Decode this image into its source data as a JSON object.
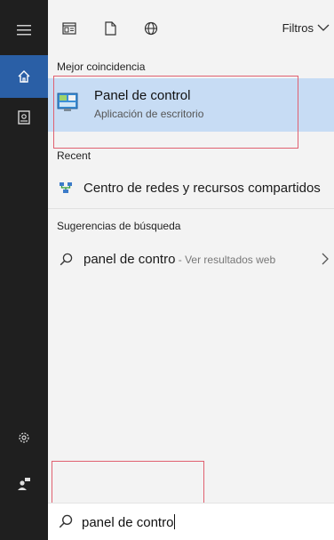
{
  "toolbar": {
    "filters_label": "Filtros"
  },
  "sections": {
    "best_match": "Mejor coincidencia",
    "recent": "Recent",
    "suggestions": "Sugerencias de búsqueda"
  },
  "best_match": {
    "title": "Panel de control",
    "subtitle": "Aplicación de escritorio"
  },
  "recent_items": [
    {
      "label": "Centro de redes y recursos compartidos",
      "icon": "network-center-icon"
    }
  ],
  "suggestions": [
    {
      "label": "panel de contro",
      "suffix": " - Ver resultados web"
    }
  ],
  "search": {
    "value": "panel de contro"
  },
  "colors": {
    "rail": "#1f1f1f",
    "rail_active": "#2a5fa6",
    "selected": "#c7dcf4",
    "panel": "#f3f3f3",
    "highlight_box": "#e06070"
  }
}
